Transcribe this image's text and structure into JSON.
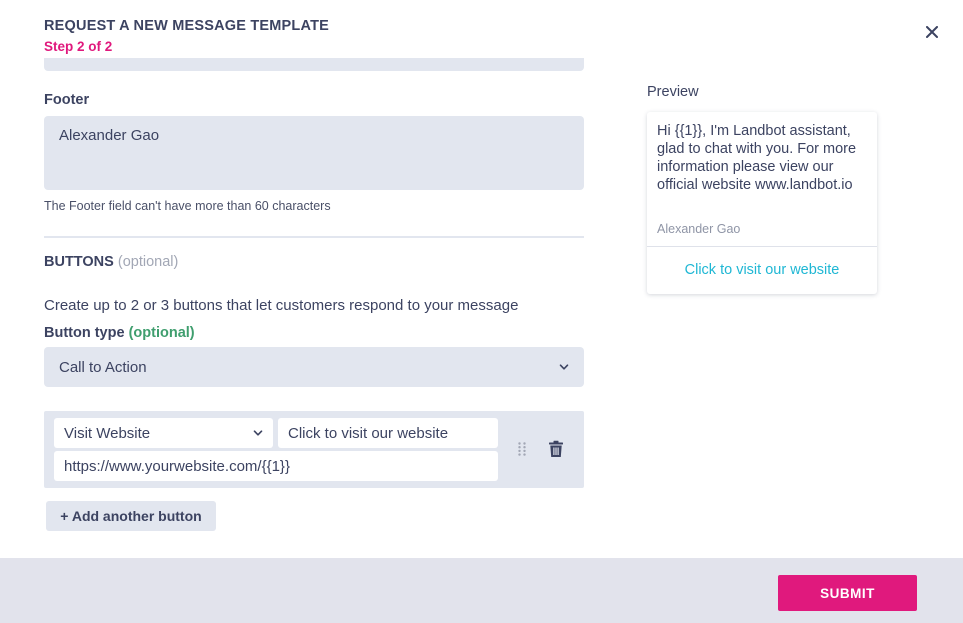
{
  "header": {
    "title": "REQUEST A NEW MESSAGE TEMPLATE",
    "step": "Step 2 of 2",
    "close_icon": "close-icon"
  },
  "footer_field": {
    "label": "Footer",
    "value": "Alexander Gao",
    "hint": "The Footer field can't have more than 60 characters"
  },
  "buttons_section": {
    "title": "BUTTONS",
    "optional": "(optional)",
    "description": "Create up to 2 or 3 buttons that let customers respond to your message",
    "type_label": "Button type",
    "type_optional": "(optional)",
    "type_value": "Call to Action",
    "button_row": {
      "action_type": "Visit Website",
      "button_text": "Click to visit our website",
      "url": "https://www.yourwebsite.com/{{1}}",
      "drag_icon": "drag-handle-icon",
      "delete_icon": "trash-icon"
    },
    "add_button_label": "+ Add another button"
  },
  "preview": {
    "label": "Preview",
    "body": "Hi {{1}}, I'm Landbot assistant, glad to chat with you. For more information please view our official website www.landbot.io",
    "footer": "Alexander Gao",
    "button": "Click to visit our website"
  },
  "actions": {
    "submit_label": "SUBMIT"
  },
  "colors": {
    "accent": "#e0197d",
    "field_bg": "#e2e6ef",
    "text": "#3c4361",
    "link": "#1fb7d4",
    "optional_green": "#3f9e6e"
  }
}
